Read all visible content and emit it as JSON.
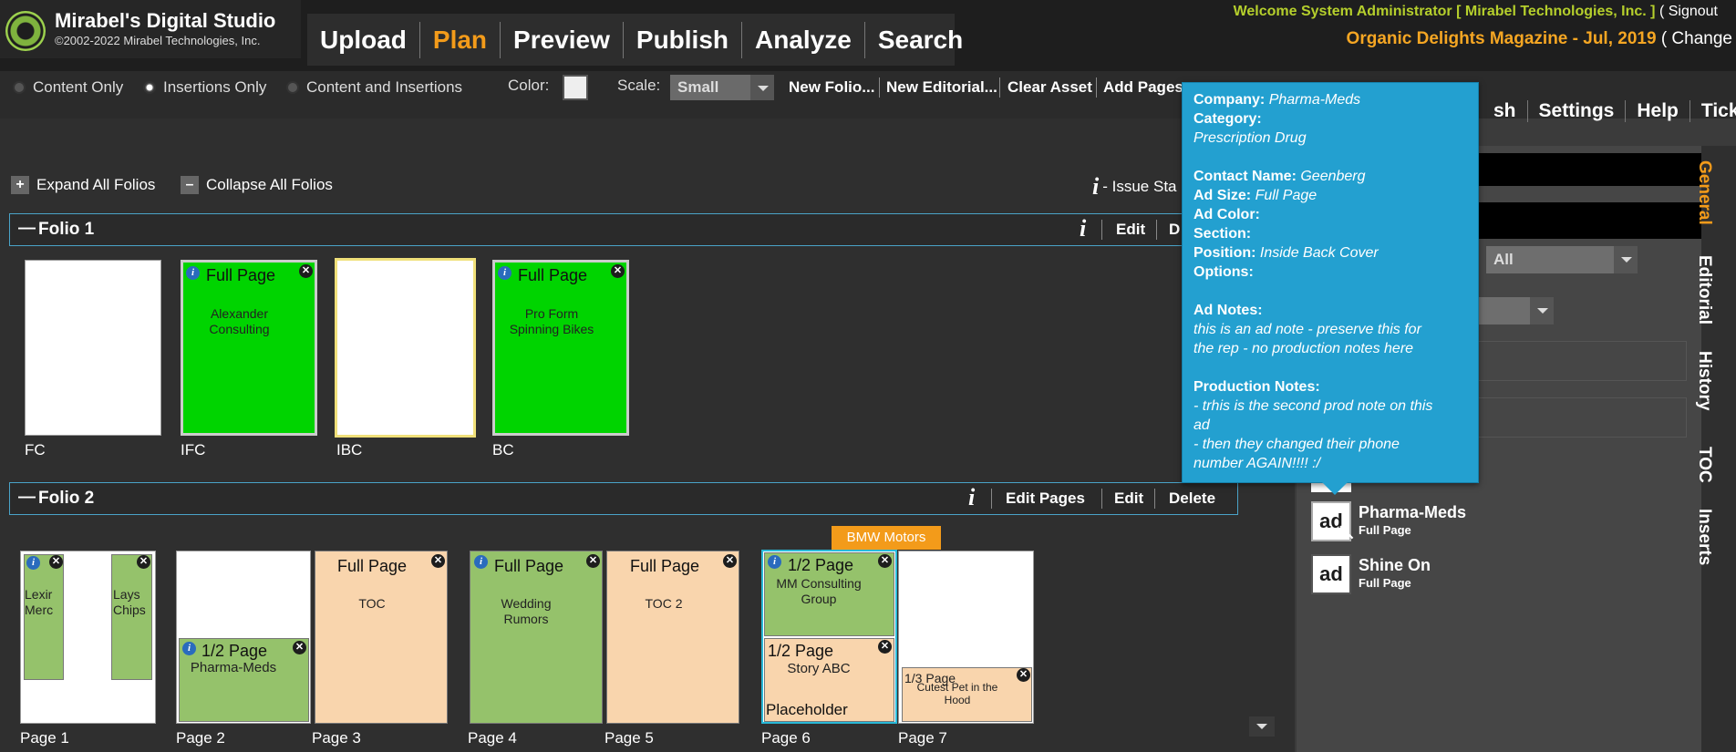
{
  "app": {
    "logo_title": "Mirabel's Digital Studio",
    "logo_copyright": "©2002-2022 Mirabel Technologies, Inc.",
    "nav": [
      "Upload",
      "Plan",
      "Preview",
      "Publish",
      "Analyze",
      "Search"
    ],
    "active_nav": "Plan",
    "welcome": "Welcome System Administrator [ Mirabel Technologies, Inc. ]",
    "signout": "( Signout",
    "issue": "Organic Delights Magazine - Jul, 2019",
    "change": "( Change"
  },
  "toolbar": {
    "view_options": [
      "Content Only",
      "Insertions Only",
      "Content and Insertions"
    ],
    "selected_view": "Insertions Only",
    "color_label": "Color:",
    "scale_label": "Scale:",
    "scale_value": "Small",
    "buttons": [
      "New Folio...",
      "New Editorial...",
      "Clear Asset",
      "Add Pages"
    ]
  },
  "right_nav": [
    "Settings",
    "Help",
    "Ticket"
  ],
  "right_nav_partial": "sh",
  "main": {
    "expand_all": "Expand All Folios",
    "collapse_all": "Collapse All Folios",
    "issue_status": "- Issue Sta",
    "folio1": {
      "title": "Folio 1",
      "actions": [
        "Edit",
        "D"
      ],
      "pages": [
        {
          "label": "FC"
        },
        {
          "label": "IFC",
          "ad_size": "Full Page",
          "ad_name": "Alexander Consulting"
        },
        {
          "label": "IBC"
        },
        {
          "label": "BC",
          "ad_size": "Full Page",
          "ad_name": "Pro Form Spinning Bikes"
        }
      ]
    },
    "folio2": {
      "title": "Folio 2",
      "actions": [
        "Edit Pages",
        "Edit",
        "Delete"
      ],
      "bmw_badge": "BMW Motors",
      "pages": [
        {
          "label": "Page 1",
          "ads": [
            "Lexir Merc",
            "Lays Chips"
          ]
        },
        {
          "label": "Page 2",
          "ad_size": "1/2 Page",
          "ad_name": "Pharma-Meds"
        },
        {
          "label": "Page 3",
          "ad_size": "Full Page",
          "ad_name": "TOC"
        },
        {
          "label": "Page 4",
          "ad_size": "Full Page",
          "ad_name": "Wedding Rumors"
        },
        {
          "label": "Page 5",
          "ad_size": "Full Page",
          "ad_name": "TOC 2"
        },
        {
          "label": "Page 6",
          "top_size": "1/2 Page",
          "top_name": "MM Consulting Group",
          "bottom_size": "1/2 Page",
          "bottom_name": "Story ABC",
          "bottom_note": "Placeholder"
        },
        {
          "label": "Page 7",
          "ad_size": "1/3 Page",
          "ad_name": "Cutest Pet in the Hood"
        }
      ]
    }
  },
  "right_panel": {
    "filter_value": "All",
    "ads": [
      {
        "name": "Pharma-Meds",
        "size": "Full Page",
        "icon": "ad"
      },
      {
        "name": "Shine On",
        "size": "Full Page",
        "icon": "ad"
      }
    ],
    "tabs": [
      "General",
      "Editorial",
      "History",
      "TOC",
      "Inserts"
    ]
  },
  "tooltip": {
    "company_k": "Company:",
    "company_v": "Pharma-Meds",
    "category_k": "Category:",
    "category_v": "Prescription Drug",
    "contact_k": "Contact Name:",
    "contact_v": "Geenberg",
    "adsize_k": "Ad Size:",
    "adsize_v": "Full Page",
    "adcolor_k": "Ad Color:",
    "section_k": "Section:",
    "position_k": "Position:",
    "position_v": "Inside Back Cover",
    "options_k": "Options:",
    "adnotes_k": "Ad Notes:",
    "adnotes_v1": "this is an ad note - preserve this for",
    "adnotes_v2": "the rep - no production notes here",
    "prodnotes_k": "Production Notes:",
    "prodnotes_v1": "- trhis is the second prod note on this",
    "prodnotes_v2": "ad",
    "prodnotes_v3": "- then they changed their phone",
    "prodnotes_v4": "number AGAIN!!!! :/"
  },
  "colors": {
    "accent": "#f39b1a",
    "welcome": "#b5cf2c",
    "tooltip": "#23a0d0",
    "ad_green": "#00d400",
    "ad_green_soft": "#95c26b",
    "ad_peach": "#f9d5ad"
  }
}
